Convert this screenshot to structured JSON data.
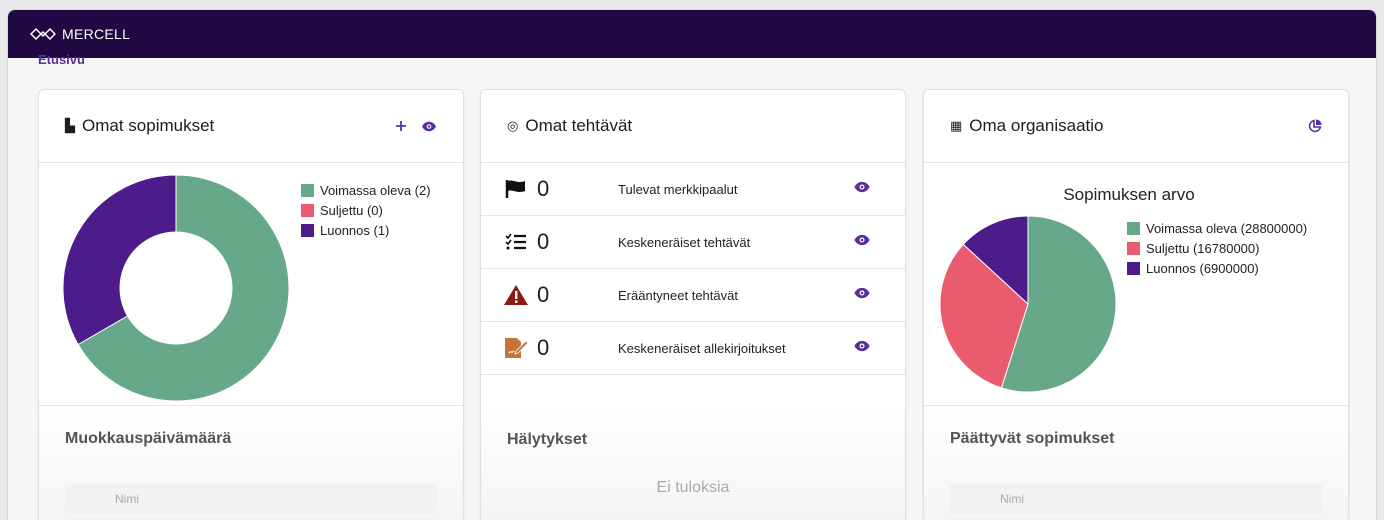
{
  "app": {
    "brand": "MERCELL"
  },
  "breadcrumb": "Etusivu",
  "colors": {
    "green": "#67a88b",
    "red": "#e95b6d",
    "purple": "#4d1c8a",
    "topbar": "#200842",
    "accent": "#5b2ea0"
  },
  "cards": {
    "contracts": {
      "title": "Omat sopimukset",
      "icons": [
        "document-icon",
        "add-icon",
        "eye-icon"
      ],
      "legend": [
        "Voimassa oleva (2)",
        "Suljettu (0)",
        "Luonnos (1)"
      ],
      "lower_title": "Muokkauspäivämäärä",
      "column_header": "Nimi"
    },
    "tasks": {
      "title": "Omat tehtävät",
      "rows": [
        {
          "icon": "flag-icon",
          "count": "0",
          "label": "Tulevat merkkipaalut"
        },
        {
          "icon": "checklist-icon",
          "count": "0",
          "label": "Keskeneräiset tehtävät"
        },
        {
          "icon": "warning-icon",
          "count": "0",
          "label": "Erääntyneet tehtävät"
        },
        {
          "icon": "signature-icon",
          "count": "0",
          "label": "Keskeneräiset allekirjoitukset"
        }
      ],
      "lower_title": "Hälytykset",
      "empty_text": "Ei tuloksia"
    },
    "organization": {
      "title": "Oma organisaatio",
      "chart_title": "Sopimuksen arvo",
      "legend": [
        "Voimassa oleva (28800000)",
        "Suljettu (16780000)",
        "Luonnos (6900000)"
      ],
      "lower_title": "Päättyvät sopimukset",
      "column_header": "Nimi"
    }
  },
  "chart_data": [
    {
      "type": "pie",
      "variant": "donut",
      "categories": [
        "Voimassa oleva",
        "Suljettu",
        "Luonnos"
      ],
      "values": [
        2,
        0,
        1
      ],
      "colors": [
        "#67a88b",
        "#e95b6d",
        "#4d1c8a"
      ]
    },
    {
      "type": "pie",
      "title": "Sopimuksen arvo",
      "categories": [
        "Voimassa oleva",
        "Suljettu",
        "Luonnos"
      ],
      "values": [
        28800000,
        16780000,
        6900000
      ],
      "colors": [
        "#67a88b",
        "#e95b6d",
        "#4d1c8a"
      ]
    }
  ]
}
